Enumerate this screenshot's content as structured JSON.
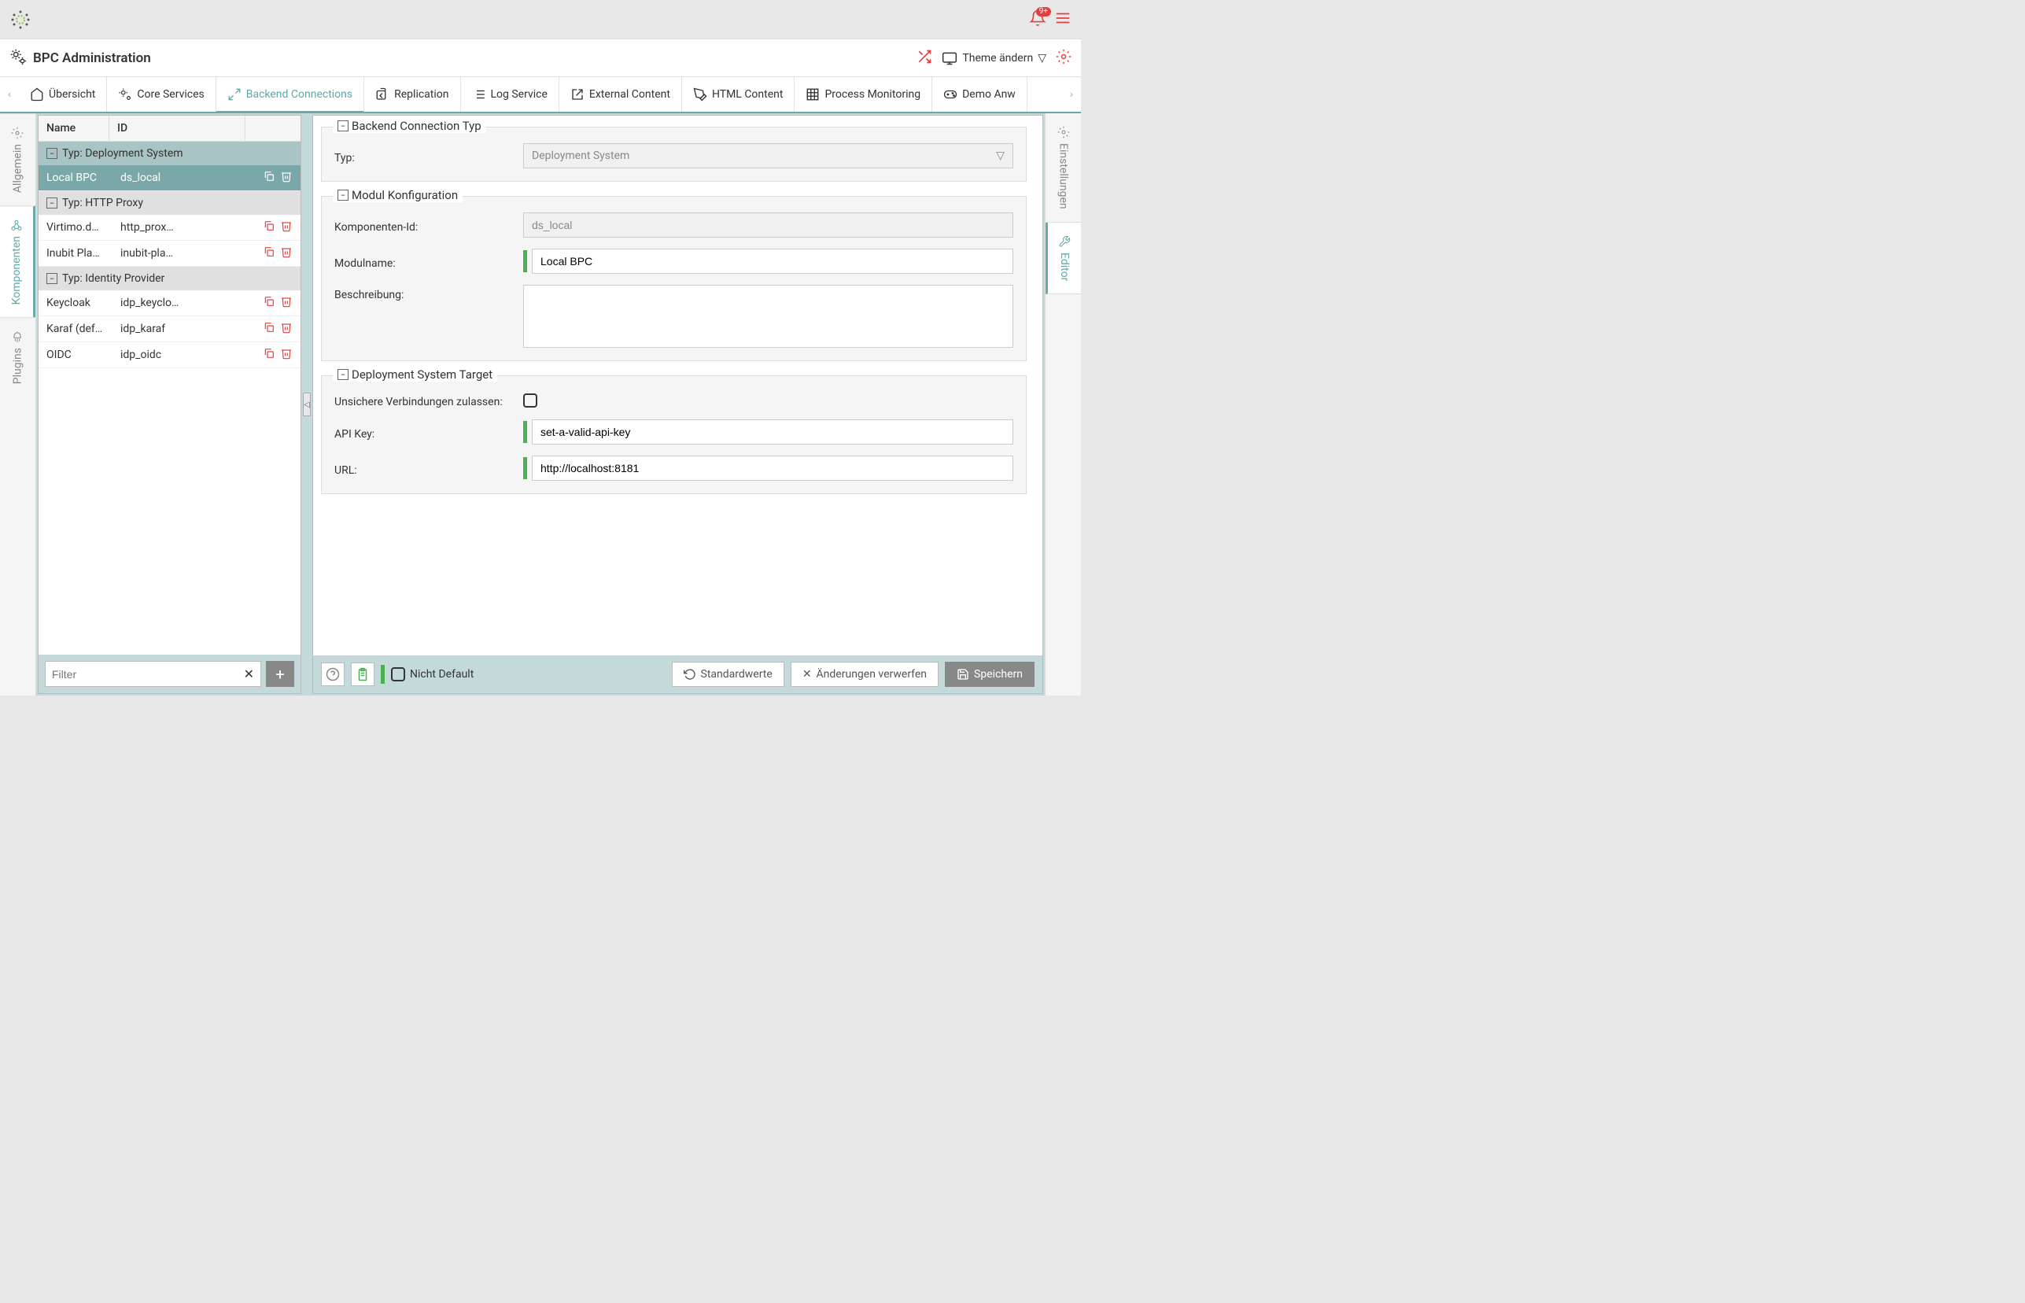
{
  "topBar": {
    "notif_count": "9+"
  },
  "adminBar": {
    "title": "BPC Administration",
    "theme_label": "Theme ändern"
  },
  "tabs": [
    {
      "label": "Übersicht"
    },
    {
      "label": "Core Services"
    },
    {
      "label": "Backend Connections"
    },
    {
      "label": "Replication"
    },
    {
      "label": "Log Service"
    },
    {
      "label": "External Content"
    },
    {
      "label": "HTML Content"
    },
    {
      "label": "Process Monitoring"
    },
    {
      "label": "Demo Anw"
    }
  ],
  "leftRail": [
    {
      "label": "Allgemein"
    },
    {
      "label": "Komponenten"
    },
    {
      "label": "Plugins"
    }
  ],
  "rightRail": [
    {
      "label": "Einstellungen"
    },
    {
      "label": "Editor"
    }
  ],
  "list": {
    "col_name": "Name",
    "col_id": "ID",
    "groups": [
      {
        "label": "Typ: Deployment System",
        "rows": [
          {
            "name": "Local BPC",
            "id": "ds_local"
          }
        ]
      },
      {
        "label": "Typ: HTTP Proxy",
        "rows": [
          {
            "name": "Virtimo.d…",
            "id": "http_prox…"
          },
          {
            "name": "Inubit Pla…",
            "id": "inubit-pla…"
          }
        ]
      },
      {
        "label": "Typ: Identity Provider",
        "rows": [
          {
            "name": "Keycloak",
            "id": "idp_keyclo…"
          },
          {
            "name": "Karaf (def…",
            "id": "idp_karaf"
          },
          {
            "name": "OIDC",
            "id": "idp_oidc"
          }
        ]
      }
    ],
    "filter_placeholder": "Filter"
  },
  "detail": {
    "section1_title": "Backend Connection Typ",
    "typ_label": "Typ:",
    "typ_value": "Deployment System",
    "section2_title": "Modul Konfiguration",
    "componentId_label": "Komponenten-Id:",
    "componentId_value": "ds_local",
    "modulname_label": "Modulname:",
    "modulname_value": "Local BPC",
    "beschreibung_label": "Beschreibung:",
    "beschreibung_value": "",
    "section3_title": "Deployment System Target",
    "unsichere_label": "Unsichere Verbindungen zulassen:",
    "apikey_label": "API Key:",
    "apikey_value": "set-a-valid-api-key",
    "url_label": "URL:",
    "url_value": "http://localhost:8181"
  },
  "footer": {
    "nicht_default": "Nicht Default",
    "standardwerte": "Standardwerte",
    "verwerfen": "Änderungen verwerfen",
    "speichern": "Speichern"
  }
}
